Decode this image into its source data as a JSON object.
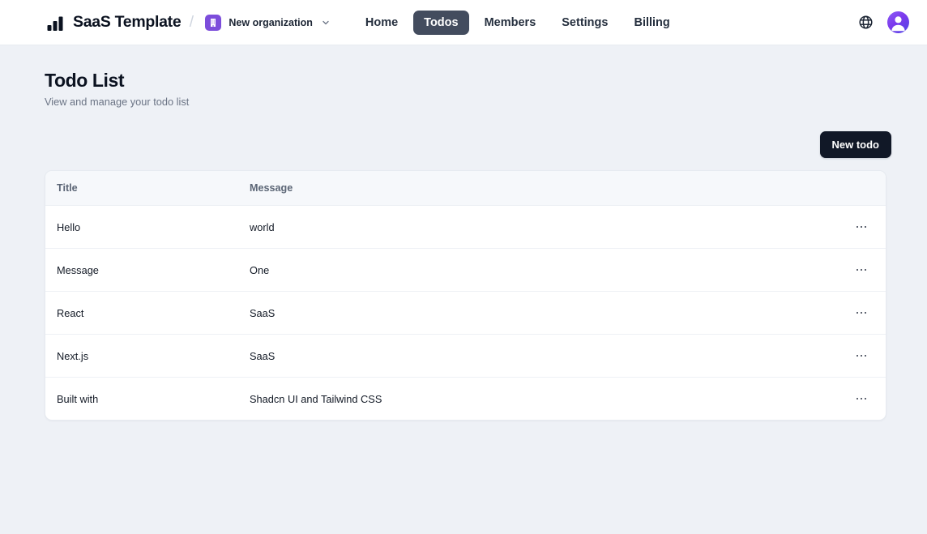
{
  "topbar": {
    "brand_name": "SaaS Template",
    "brand_logo_icon": "bar-chart-icon",
    "divider": "/",
    "org_badge_icon": "building-icon",
    "org_name": "New organization",
    "org_chevron_icon": "chevron-down-icon",
    "nav": [
      {
        "label": "Home",
        "active": false
      },
      {
        "label": "Todos",
        "active": true
      },
      {
        "label": "Members",
        "active": false
      },
      {
        "label": "Settings",
        "active": false
      },
      {
        "label": "Billing",
        "active": false
      }
    ],
    "language_icon": "globe-icon",
    "avatar_icon": "user-avatar-icon"
  },
  "page": {
    "title": "Todo List",
    "subtitle": "View and manage your todo list",
    "new_todo_label": "New todo"
  },
  "table": {
    "columns": [
      "Title",
      "Message"
    ],
    "row_action_icon": "ellipsis-horizontal-icon",
    "rows": [
      {
        "title": "Hello",
        "message": "world"
      },
      {
        "title": "Message",
        "message": "One"
      },
      {
        "title": "React",
        "message": "SaaS"
      },
      {
        "title": "Next.js",
        "message": "SaaS"
      },
      {
        "title": "Built with",
        "message": "Shadcn UI and Tailwind CSS"
      }
    ]
  },
  "colors": {
    "page_background": "#eef1f6",
    "surface": "#ffffff",
    "accent_purple": "#7c4ddb",
    "active_tab": "#434c5e",
    "primary_button": "#111827"
  }
}
